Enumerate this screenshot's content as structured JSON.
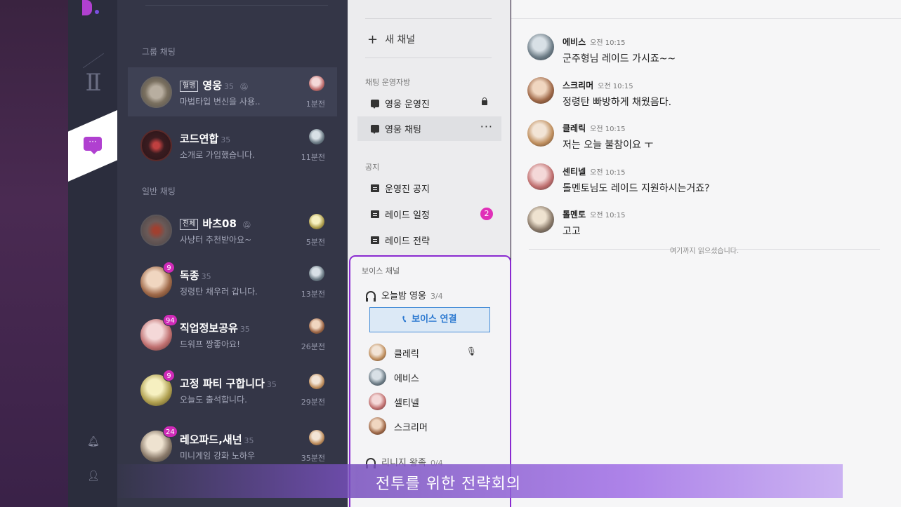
{
  "colors": {
    "accent": "#b040d0",
    "badge": "#d02ab8",
    "voice_border": "#8a2ad0",
    "link_blue": "#2a78d0"
  },
  "rail": {
    "chat_icon": "chat-bubble-icon",
    "bell_icon": "bell-icon",
    "user_icon": "user-icon"
  },
  "chat_list": {
    "group_label": "그룹 채팅",
    "general_label": "일반 채팅",
    "items": [
      {
        "tag": "혈맹",
        "title": "영웅",
        "count": "35",
        "preview": "마법타입 변신을 사용..",
        "time": "1분전",
        "badge": ""
      },
      {
        "tag": "",
        "title": "코드연합",
        "count": "35",
        "preview": "소개로 가입했습니다.",
        "time": "11분전",
        "badge": ""
      },
      {
        "tag": "전체",
        "title": "바츠08",
        "count": "",
        "preview": "사냥터 추천받아요~",
        "time": "5분전",
        "badge": ""
      },
      {
        "tag": "",
        "title": "독종",
        "count": "35",
        "preview": "정령탄 채우러 갑니다.",
        "time": "13분전",
        "badge": "9"
      },
      {
        "tag": "",
        "title": "직업정보공유",
        "count": "35",
        "preview": "드워프 짱좋아요!",
        "time": "26분전",
        "badge": "94"
      },
      {
        "tag": "",
        "title": "고정 파티 구합니다",
        "count": "35",
        "preview": "오늘도 출석합니다.",
        "time": "29분전",
        "badge": "9"
      },
      {
        "tag": "",
        "title": "레오파드,새넌",
        "count": "35",
        "preview": "미니게임 강화 노하우",
        "time": "35분전",
        "badge": "24"
      }
    ]
  },
  "channels": {
    "new_channel": "새 채널",
    "ops_label": "채팅 운영자방",
    "ops_items": [
      {
        "label": "영웅 운영진"
      },
      {
        "label": "영웅 채팅"
      }
    ],
    "notice_label": "공지",
    "notice_items": [
      {
        "label": "운영진 공지"
      },
      {
        "label": "레이드 일정",
        "badge": "2"
      },
      {
        "label": "레이드 전략"
      }
    ]
  },
  "voice": {
    "section_label": "보이스 채널",
    "room1": {
      "name": "오늘밤 영웅",
      "capacity": "3/4"
    },
    "connect_button": "보이스 연결",
    "members": [
      {
        "name": "클레릭"
      },
      {
        "name": "에비스"
      },
      {
        "name": "셀티넬"
      },
      {
        "name": "스크리머"
      }
    ],
    "room2": {
      "name": "리니지 왕족",
      "capacity": "0/4"
    }
  },
  "messages": [
    {
      "name": "에비스",
      "time": "오전 10:15",
      "text": "군주형님 레이드 가시죠~~"
    },
    {
      "name": "스크리머",
      "time": "오전 10:15",
      "text": "정령탄 빠방하게 채웠음다."
    },
    {
      "name": "클레릭",
      "time": "오전 10:15",
      "text": "저는 오늘 불참이요 ㅜ"
    },
    {
      "name": "센티넬",
      "time": "오전 10:15",
      "text": "톨멘토님도 레이드 지원하시는거죠?"
    },
    {
      "name": "톨멘토",
      "time": "오전 10:15",
      "text": "고고"
    }
  ],
  "read_marker": "여기까지 읽으셨습니다.",
  "subtitle": "전투를 위한 전략회의"
}
